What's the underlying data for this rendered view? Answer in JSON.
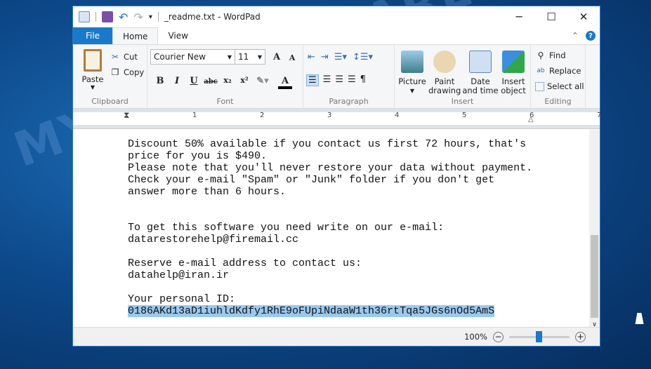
{
  "window": {
    "title": "_readme.txt - WordPad",
    "minimize": "─",
    "maximize": "☐",
    "close": "✕"
  },
  "tabs": [
    {
      "label": "File"
    },
    {
      "label": "Home"
    },
    {
      "label": "View"
    }
  ],
  "ribbon": {
    "clipboard": {
      "label": "Clipboard",
      "paste": "Paste",
      "cut": "Cut",
      "copy": "Copy"
    },
    "font": {
      "label": "Font",
      "family": "Courier New",
      "size": "11"
    },
    "paragraph": {
      "label": "Paragraph"
    },
    "insert": {
      "label": "Insert",
      "picture": "Picture",
      "paint": "Paint drawing",
      "datetime": "Date and time",
      "object": "Insert object"
    },
    "editing": {
      "label": "Editing",
      "find": "Find",
      "replace": "Replace",
      "select_all": "Select all"
    }
  },
  "ruler": {
    "marks": [
      "1",
      "2",
      "3",
      "4",
      "5",
      "6",
      "7"
    ]
  },
  "document": {
    "lines": [
      "Discount 50% available if you contact us first 72 hours, that's",
      "price for you is $490.",
      "Please note that you'll never restore your data without payment.",
      "Check your e-mail \"Spam\" or \"Junk\" folder if you don't get",
      "answer more than 6 hours.",
      "",
      "",
      "To get this software you need write on our e-mail:",
      "datarestorehelp@firemail.cc",
      "",
      "Reserve e-mail address to contact us:",
      "datahelp@iran.ir",
      "",
      "Your personal ID:"
    ],
    "selected_id": "0186AKd13aD1iuhldKdfy1RhE9oFUpiNdaaW1th36rtTqa5JGs6nOd5AmS"
  },
  "status": {
    "zoom": "100%",
    "zoom_value_percent": 100
  },
  "watermark": "MYANTISPYWARE.COM",
  "colors": {
    "accent": "#1979ca",
    "selection": "#99c9ef"
  }
}
